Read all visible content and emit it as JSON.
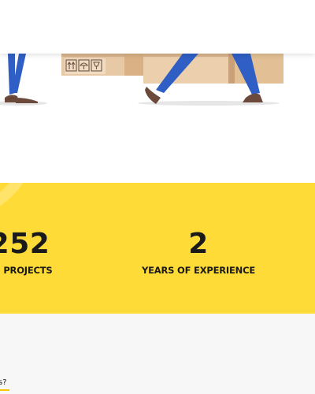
{
  "stats": [
    {
      "number": "252",
      "label": "ED PROJECTS"
    },
    {
      "number": "2",
      "label": "YEARS OF EXPERIENCE"
    }
  ],
  "faq": {
    "heading": "s?"
  },
  "colors": {
    "band": "#ffdb37",
    "text": "#1a1a1a",
    "legs": "#2f5fc4",
    "box": "#e9c9a4",
    "accent": "#f7c600"
  },
  "icons": [
    "box-this-way-up-icon",
    "box-umbrella-icon",
    "box-fragile-icon"
  ]
}
